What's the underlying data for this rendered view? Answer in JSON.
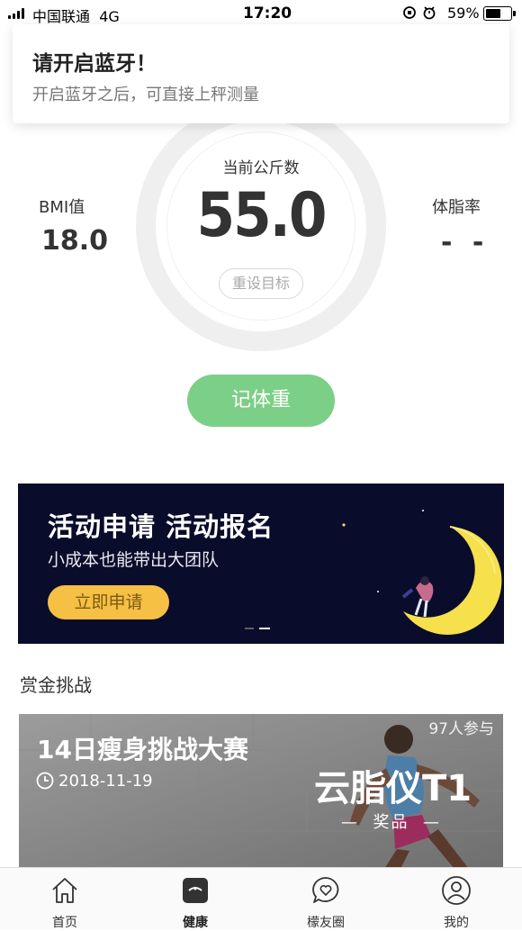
{
  "status_bar": {
    "carrier": "中国联通",
    "network": "4G",
    "time": "17:20",
    "battery": "59%",
    "battery_level": 0.59
  },
  "banner": {
    "title": "请开启蓝牙！",
    "message": "开启蓝牙之后，可直接上秤测量"
  },
  "weight": {
    "label": "当前公斤数",
    "value": "55.0",
    "reset_label": "重设目标"
  },
  "bmi": {
    "label": "BMI值",
    "value": "18.0"
  },
  "body_fat": {
    "label": "体脂率",
    "value": "- -"
  },
  "record_button": "记体重",
  "promo": {
    "title": "活动申请 活动报名",
    "subtitle": "小成本也能带出大团队",
    "button": "立即申请",
    "slide_count": 2,
    "active_slide": 2
  },
  "section_title": "赏金挑战",
  "challenge": {
    "title": "14日瘦身挑战大赛",
    "date": "2018-11-19",
    "participants": "97人参与",
    "prize_name": "云脂仪T1",
    "prize_label": "奖品"
  },
  "tabs": [
    {
      "label": "首页",
      "icon": "home-icon"
    },
    {
      "label": "健康",
      "icon": "scale-icon"
    },
    {
      "label": "檬友圈",
      "icon": "heart-chat-icon"
    },
    {
      "label": "我的",
      "icon": "user-icon"
    }
  ],
  "colors": {
    "accent_green": "#7ccf86",
    "promo_bg": "#0a0c2c",
    "promo_button": "#f5c043"
  }
}
